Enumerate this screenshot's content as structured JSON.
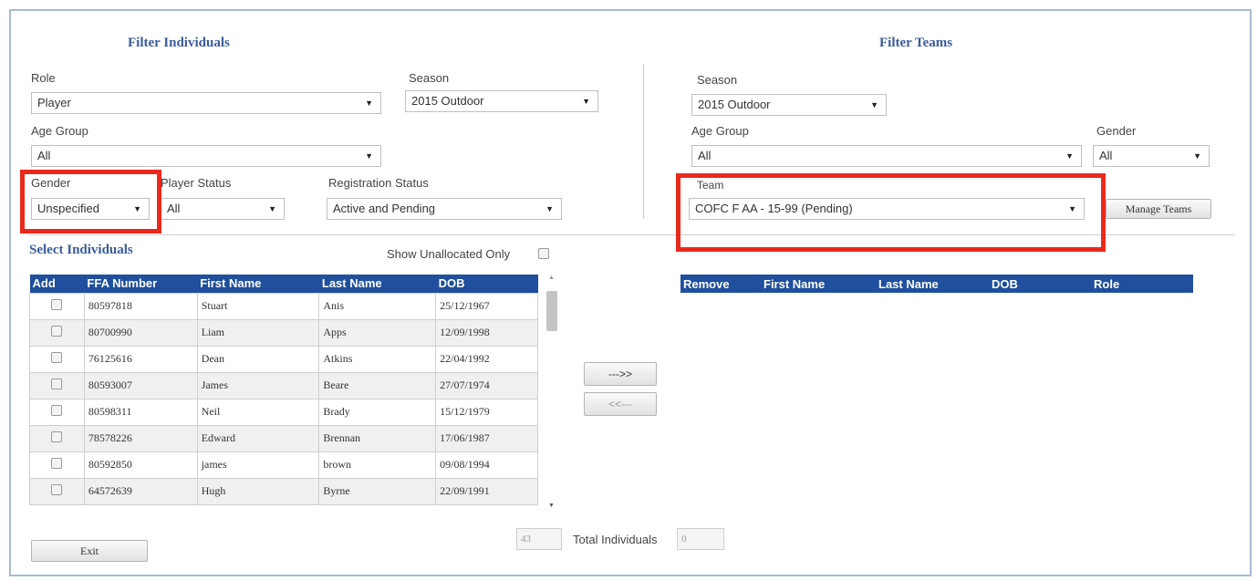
{
  "filter_individuals": {
    "title": "Filter Individuals",
    "role_label": "Role",
    "role_value": "Player",
    "season_label": "Season",
    "season_value": "2015 Outdoor",
    "age_group_label": "Age Group",
    "age_group_value": "All",
    "gender_label": "Gender",
    "gender_value": "Unspecified",
    "player_status_label": "Player Status",
    "player_status_value": "All",
    "registration_status_label": "Registration Status",
    "registration_status_value": "Active and Pending"
  },
  "filter_teams": {
    "title": "Filter Teams",
    "season_label": "Season",
    "season_value": "2015 Outdoor",
    "age_group_label": "Age Group",
    "age_group_value": "All",
    "gender_label": "Gender",
    "gender_value": "All",
    "team_label": "Team",
    "team_value": "COFC F AA - 15-99 (Pending)",
    "manage_teams_label": "Manage Teams"
  },
  "select_individuals": {
    "title": "Select Individuals",
    "show_unallocated_label": "Show Unallocated Only",
    "columns": [
      "Add",
      "FFA Number",
      "First Name",
      "Last Name",
      "DOB"
    ],
    "rows": [
      {
        "ffa": "80597818",
        "first": "Stuart",
        "last": "Anis",
        "dob": "25/12/1967"
      },
      {
        "ffa": "80700990",
        "first": "Liam",
        "last": "Apps",
        "dob": "12/09/1998"
      },
      {
        "ffa": "76125616",
        "first": "Dean",
        "last": "Atkins",
        "dob": "22/04/1992"
      },
      {
        "ffa": "80593007",
        "first": "James",
        "last": "Beare",
        "dob": "27/07/1974"
      },
      {
        "ffa": "80598311",
        "first": "Neil",
        "last": "Brady",
        "dob": "15/12/1979"
      },
      {
        "ffa": "78578226",
        "first": "Edward",
        "last": "Brennan",
        "dob": "17/06/1987"
      },
      {
        "ffa": "80592850",
        "first": "james",
        "last": "brown",
        "dob": "09/08/1994"
      },
      {
        "ffa": "64572639",
        "first": "Hugh",
        "last": "Byrne",
        "dob": "22/09/1991"
      }
    ],
    "count_value": "43"
  },
  "team_members": {
    "columns": [
      "Remove",
      "First Name",
      "Last Name",
      "DOB",
      "Role"
    ],
    "total_label": "Total Individuals",
    "total_value": "0"
  },
  "transfer": {
    "add_label": "--->>",
    "remove_label": "<<---"
  },
  "exit_label": "Exit",
  "colors": {
    "header_blue": "#1f4f9d",
    "title_blue": "#3b5b9e",
    "highlight_red": "#e8291c"
  }
}
